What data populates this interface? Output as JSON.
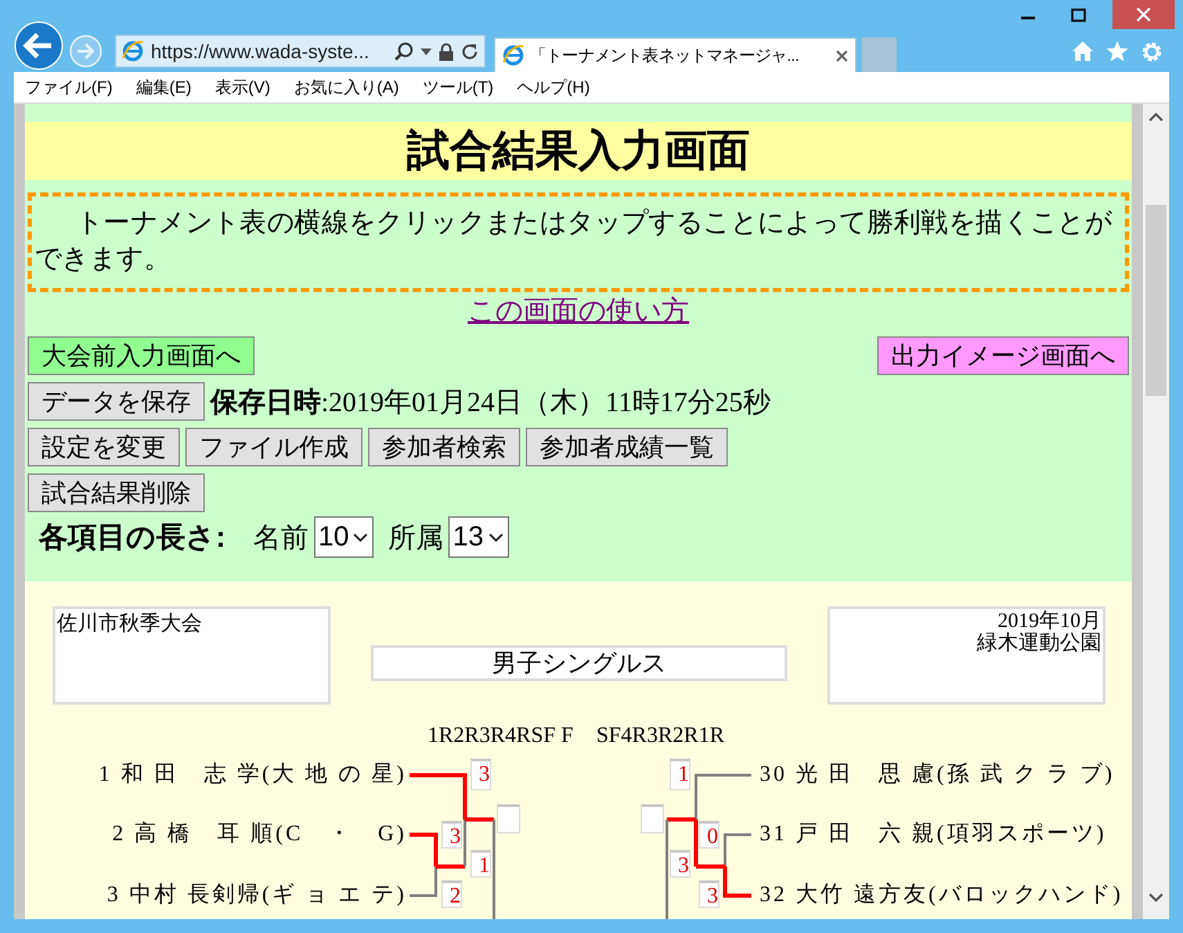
{
  "browser": {
    "address": "https://www.wada-syste...",
    "tab_title": "「トーナメント表ネットマネージャ...",
    "menu": [
      "ファイル(F)",
      "編集(E)",
      "表示(V)",
      "お気に入り(A)",
      "ツール(T)",
      "ヘルプ(H)"
    ]
  },
  "page": {
    "title": "試合結果入力画面",
    "notice": "トーナメント表の横線をクリックまたはタップすることによって勝利戦を描くことができます。",
    "help_link": "この画面の使い方",
    "nav_buttons": [
      {
        "label": "大会前入力画面へ",
        "color": "#90ff90"
      },
      {
        "label": "出力イメージ画面へ",
        "color": "#ff99ff"
      }
    ],
    "save_button": "データを保存",
    "saved_at": "**保存日時**:2019年01月24日（木）11時17分25秒",
    "tool_buttons": [
      "設定を変更",
      "ファイル作成",
      "参加者検索",
      "参加者成績一覧"
    ],
    "delete_button": "試合結果削除",
    "lengths": {
      "label": "各項目の長さ:",
      "fields": [
        {
          "label": "名前",
          "value": "10"
        },
        {
          "label": "所属",
          "value": "13"
        }
      ]
    }
  },
  "sheet": {
    "tournament_name": "佐川市秋季大会",
    "event": "男子シングルス",
    "date": "2019年10月",
    "venue": "緑木運動公園",
    "round_labels_left": "1R2R3R4RSF F",
    "round_labels_right": "SF4R3R2R1R",
    "sides": [
      {
        "players": [
          {
            "number": "1",
            "name": "和 田　志 学",
            "club": "(大 地 の 星)"
          },
          {
            "number": "2",
            "name": "高 橋　耳 順",
            "club": "(C　・　G)"
          },
          {
            "number": "3",
            "name": "中村 長剣帰",
            "club": "(ギ ョ エ テ)"
          }
        ],
        "first_round": {
          "scores": [
            {
              "value": "3",
              "won": true
            },
            {
              "value": "2",
              "won": false
            }
          ]
        },
        "second_round": {
          "scores": [
            {
              "value": "3",
              "won": true
            },
            {
              "value": "1",
              "won": false
            }
          ]
        }
      },
      {
        "players": [
          {
            "number": "30",
            "name": "光 田　思 慮",
            "club": "(孫 武 ク ラ ブ)"
          },
          {
            "number": "31",
            "name": "戸 田　六 親",
            "club": "(項羽スポーツ)"
          },
          {
            "number": "32",
            "name": "大竹 遠方友",
            "club": "(バロックハンド)"
          }
        ],
        "first_round": {
          "scores": [
            {
              "value": "0",
              "won": false
            },
            {
              "value": "3",
              "won": true
            }
          ]
        },
        "second_round": {
          "scores": [
            {
              "value": "1",
              "won": false
            },
            {
              "value": "3",
              "won": true
            }
          ]
        }
      }
    ]
  }
}
